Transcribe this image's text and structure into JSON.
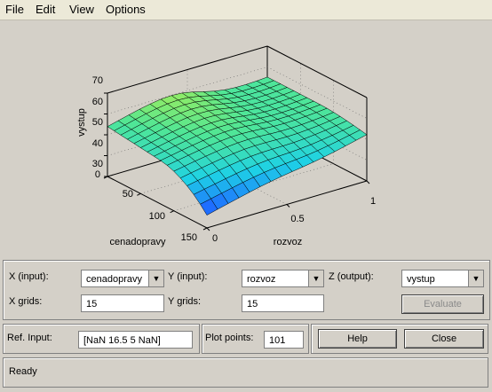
{
  "menu": [
    "File",
    "Edit",
    "View",
    "Options"
  ],
  "plot": {
    "zlabel": "vystup",
    "xlabel": "cenadopravy",
    "ylabel": "rozvoz",
    "z_ticks": [
      "70",
      "60",
      "50",
      "40",
      "30"
    ],
    "x_ticks": [
      "0",
      "50",
      "100",
      "150"
    ],
    "y_ticks": [
      "0",
      "0.5",
      "1"
    ],
    "colors": {
      "low": "#1f3fff",
      "mid": "#27d6d6",
      "high": "#f4f40a"
    }
  },
  "controls": {
    "x_label": "X (input):",
    "x_value": "cenadopravy",
    "y_label": "Y (input):",
    "y_value": "rozvoz",
    "z_label": "Z (output):",
    "z_value": "vystup",
    "xgrids_label": "X grids:",
    "xgrids_value": "15",
    "ygrids_label": "Y grids:",
    "ygrids_value": "15",
    "evaluate_label": "Evaluate"
  },
  "ref": {
    "label": "Ref. Input:",
    "value": "[NaN 16.5 5 NaN]"
  },
  "points": {
    "label": "Plot points:",
    "value": "101"
  },
  "buttons": {
    "help": "Help",
    "close": "Close"
  },
  "status": "Ready"
}
